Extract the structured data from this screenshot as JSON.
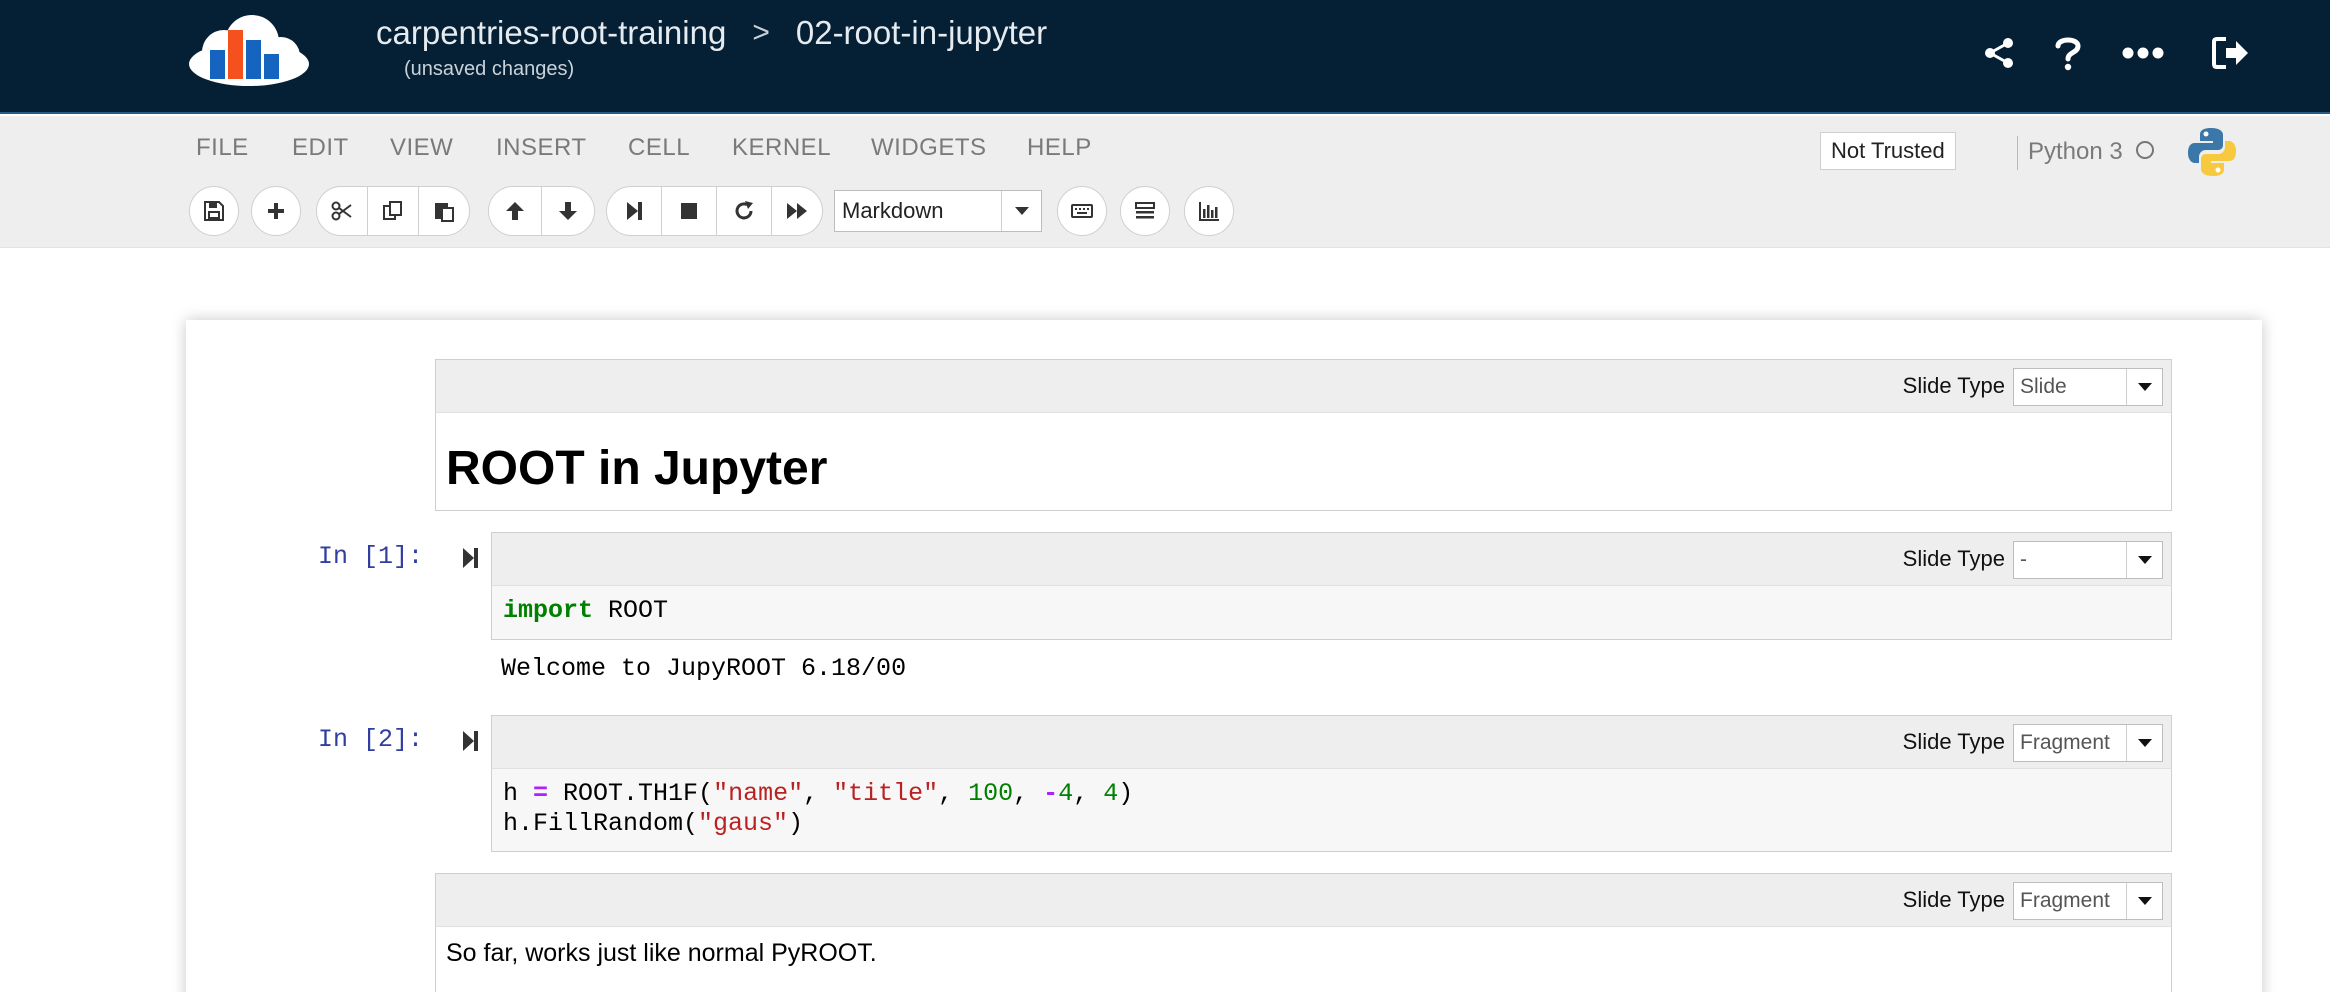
{
  "header": {
    "notebook_folder": "carpentries-root-training",
    "path_separator": ">",
    "notebook_name": "02-root-in-jupyter",
    "save_status": "(unsaved changes)",
    "icons": [
      "share-icon",
      "help-icon",
      "more-icon",
      "logout-icon"
    ],
    "colors": {
      "background": "#052035"
    }
  },
  "menu": {
    "items": [
      "FILE",
      "EDIT",
      "VIEW",
      "INSERT",
      "CELL",
      "KERNEL",
      "WIDGETS",
      "HELP"
    ]
  },
  "status": {
    "trust_label": "Not Trusted",
    "kernel_name": "Python 3"
  },
  "toolbar": {
    "buttons": [
      "save-icon",
      "plus-icon",
      "cut-icon",
      "copy-icon",
      "paste-icon",
      "arrow-up-icon",
      "arrow-down-icon",
      "step-forward-icon",
      "stop-icon",
      "restart-icon",
      "fast-forward-icon",
      "keyboard-icon",
      "list-icon",
      "bar-chart-icon"
    ],
    "cell_type": "Markdown"
  },
  "cells": {
    "slide_type_label": "Slide Type",
    "c0": {
      "slide_type": "Slide",
      "heading": "ROOT in Jupyter"
    },
    "c1": {
      "prompt": "In [1]:",
      "slide_type": "-",
      "code": {
        "keyword": "import",
        "rest": " ROOT"
      },
      "output": "Welcome to JupyROOT 6.18/00"
    },
    "c2": {
      "prompt": "In [2]:",
      "slide_type": "Fragment",
      "line1": {
        "var": "h ",
        "assign": "=",
        "call": " ROOT.TH1F(",
        "arg1": "\"name\"",
        "comma1": ", ",
        "arg2": "\"title\"",
        "comma2": ", ",
        "arg3": "100",
        "comma3": ", ",
        "minus": "-",
        "arg4": "4",
        "comma4": ", ",
        "arg5": "4",
        "close": ")"
      },
      "line2": {
        "call": "h.FillRandom(",
        "arg": "\"gaus\"",
        "close": ")"
      }
    },
    "c3": {
      "slide_type": "Fragment",
      "text": "So far, works just like normal PyROOT."
    }
  }
}
